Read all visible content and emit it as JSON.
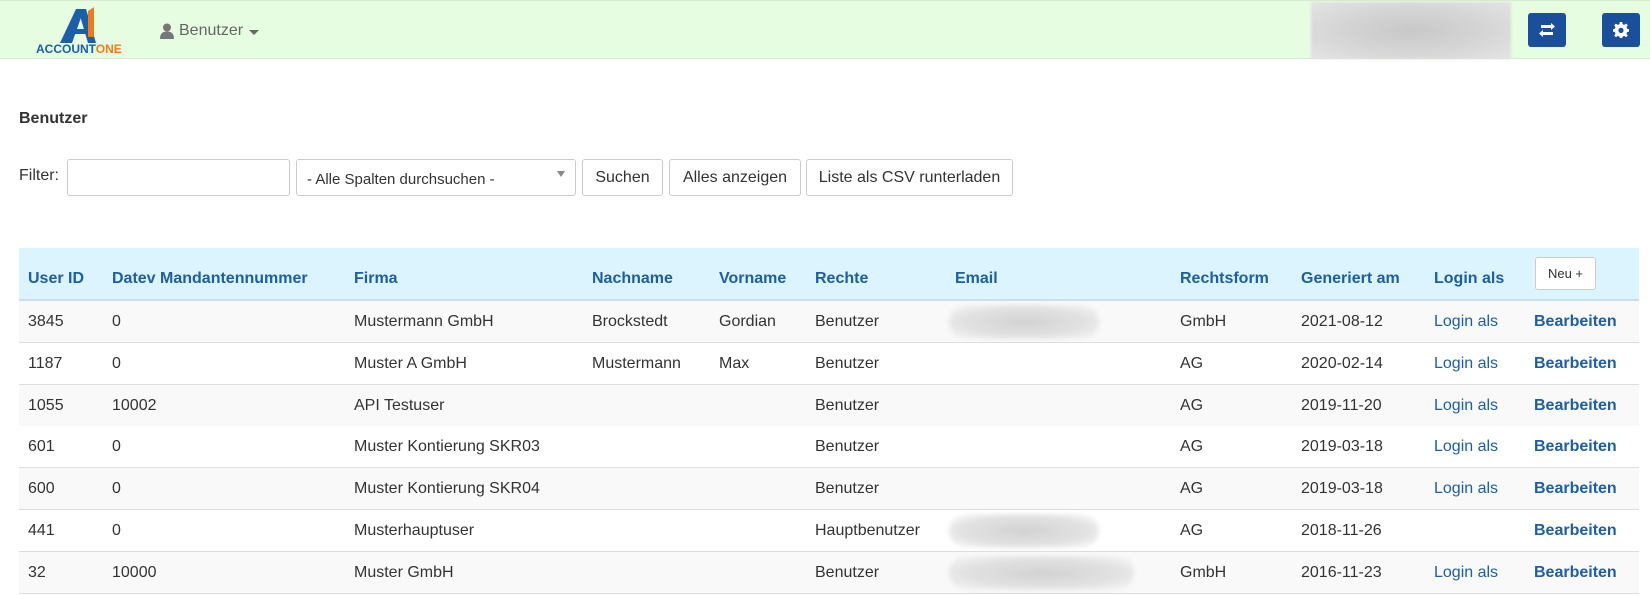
{
  "navbar": {
    "logo_text_a": "ACCOUNT",
    "logo_text_b": "ONE",
    "user_menu_label": "Benutzer",
    "icons": [
      "user-icon",
      "refresh-icon",
      "gear-icon"
    ],
    "accent_color": "#1a4f9c",
    "background_color": "#e6fde1"
  },
  "page": {
    "title": "Benutzer"
  },
  "filter": {
    "label": "Filter:",
    "input_value": "",
    "select_value": "- Alle Spalten durchsuchen -",
    "search_button": "Suchen",
    "show_all_button": "Alles anzeigen",
    "csv_button": "Liste als CSV runterladen"
  },
  "table": {
    "columns": [
      "User ID",
      "Datev Mandantennummer",
      "Firma",
      "Nachname",
      "Vorname",
      "Rechte",
      "Email",
      "Rechtsform",
      "Generiert am",
      "Login als"
    ],
    "new_button": "Neu +",
    "link_login": "Login als",
    "link_edit": "Bearbeiten",
    "rows": [
      {
        "user_id": "3845",
        "datev": "0",
        "firma": "Mustermann GmbH",
        "nachname": "Brockstedt",
        "vorname": "Gordian",
        "rechte": "Benutzer",
        "email_hidden": true,
        "rechtsform": "GmbH",
        "generiert": "2021-08-12",
        "login": "Login als",
        "edit": "Bearbeiten"
      },
      {
        "user_id": "1187",
        "datev": "0",
        "firma": "Muster A GmbH",
        "nachname": "Mustermann",
        "vorname": "Max",
        "rechte": "Benutzer",
        "email_hidden": false,
        "rechtsform": "AG",
        "generiert": "2020-02-14",
        "login": "Login als",
        "edit": "Bearbeiten"
      },
      {
        "user_id": "1055",
        "datev": "10002",
        "firma": "API Testuser",
        "nachname": "",
        "vorname": "",
        "rechte": "Benutzer",
        "email_hidden": false,
        "rechtsform": "AG",
        "generiert": "2019-11-20",
        "login": "Login als",
        "edit": "Bearbeiten"
      },
      {
        "user_id": "601",
        "datev": "0",
        "firma": "Muster Kontierung SKR03",
        "nachname": "",
        "vorname": "",
        "rechte": "Benutzer",
        "email_hidden": false,
        "rechtsform": "AG",
        "generiert": "2019-03-18",
        "login": "Login als",
        "edit": "Bearbeiten"
      },
      {
        "user_id": "600",
        "datev": "0",
        "firma": "Muster Kontierung SKR04",
        "nachname": "",
        "vorname": "",
        "rechte": "Benutzer",
        "email_hidden": false,
        "rechtsform": "AG",
        "generiert": "2019-03-18",
        "login": "Login als",
        "edit": "Bearbeiten"
      },
      {
        "user_id": "441",
        "datev": "0",
        "firma": "Musterhauptuser",
        "nachname": "",
        "vorname": "",
        "rechte": "Hauptbenutzer",
        "email_hidden": true,
        "rechtsform": "AG",
        "generiert": "2018-11-26",
        "login": "",
        "edit": "Bearbeiten"
      },
      {
        "user_id": "32",
        "datev": "10000",
        "firma": "Muster GmbH",
        "nachname": "",
        "vorname": "",
        "rechte": "Benutzer",
        "email_hidden": true,
        "rechtsform": "GmbH",
        "generiert": "2016-11-23",
        "login": "Login als",
        "edit": "Bearbeiten"
      }
    ]
  }
}
